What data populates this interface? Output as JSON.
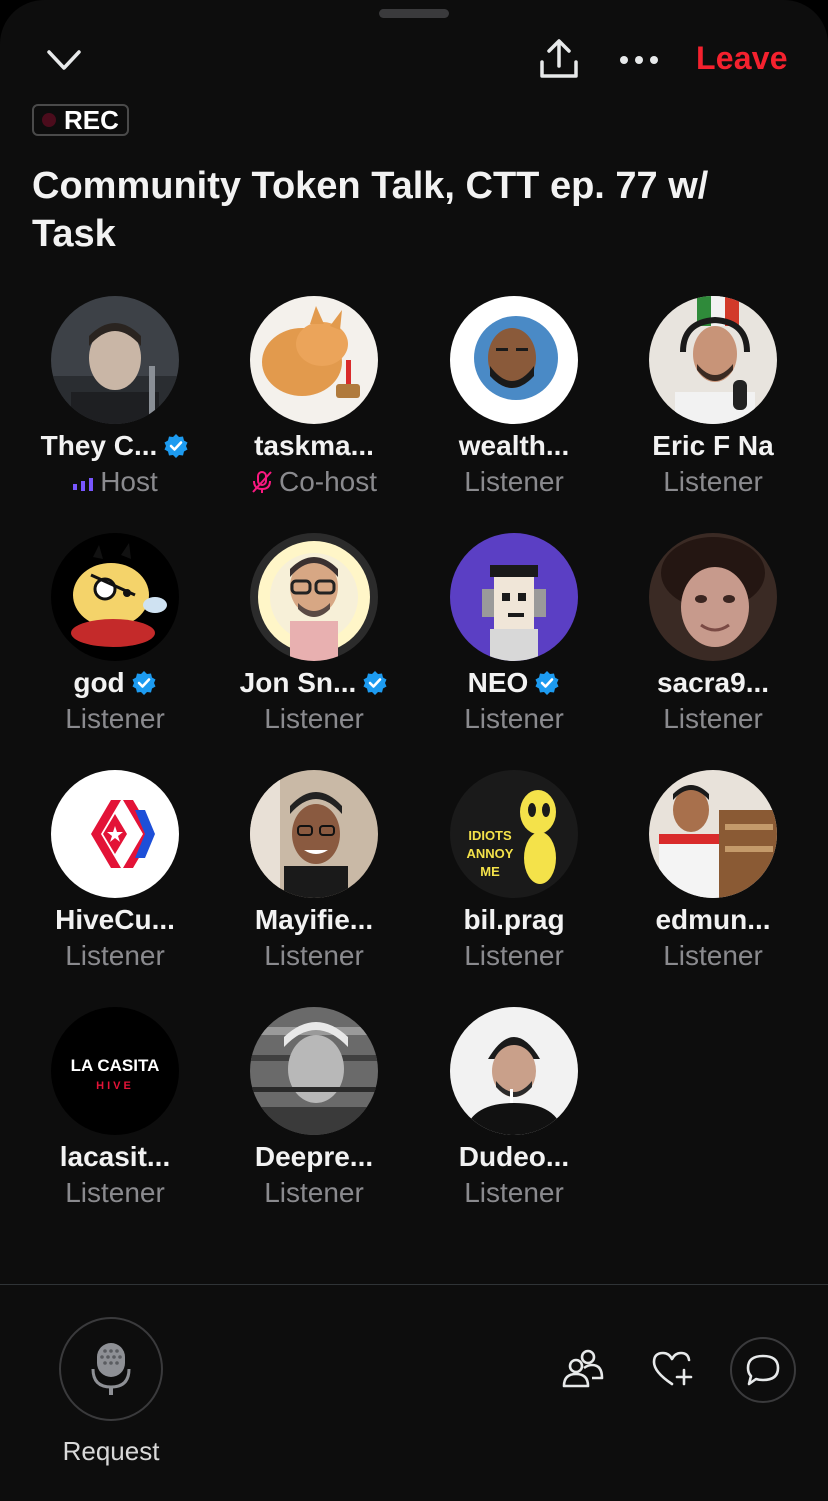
{
  "header": {
    "collapse_icon": "chevron-down-icon",
    "share_icon": "share-icon",
    "more_icon": "more-horizontal-icon",
    "leave_label": "Leave",
    "rec_label": "REC"
  },
  "space": {
    "title": "Community Token Talk, CTT ep. 77 w/ Task"
  },
  "colors": {
    "leave": "#f4212e",
    "verified": "#1d9bf0",
    "role_text": "#8a8a8e",
    "host_bars": "#7856ff",
    "cohost_mic": "#f91880"
  },
  "participants": [
    {
      "name": "They C...",
      "role": "Host",
      "verified": true,
      "role_icon": "speaking-bars-icon"
    },
    {
      "name": "taskma...",
      "role": "Co-host",
      "verified": false,
      "role_icon": "mic-muted-icon"
    },
    {
      "name": "wealth...",
      "role": "Listener",
      "verified": false
    },
    {
      "name": "Eric F Na",
      "role": "Listener",
      "verified": false
    },
    {
      "name": "god",
      "role": "Listener",
      "verified": true
    },
    {
      "name": "Jon Sn...",
      "role": "Listener",
      "verified": true
    },
    {
      "name": "NEO",
      "role": "Listener",
      "verified": true
    },
    {
      "name": "sacra9...",
      "role": "Listener",
      "verified": false
    },
    {
      "name": "HiveCu...",
      "role": "Listener",
      "verified": false
    },
    {
      "name": "Mayifie...",
      "role": "Listener",
      "verified": false
    },
    {
      "name": "bil.prag",
      "role": "Listener",
      "verified": false
    },
    {
      "name": "edmun...",
      "role": "Listener",
      "verified": false
    },
    {
      "name": "lacasit...",
      "role": "Listener",
      "verified": false
    },
    {
      "name": "Deepre...",
      "role": "Listener",
      "verified": false
    },
    {
      "name": "Dudeo...",
      "role": "Listener",
      "verified": false
    }
  ],
  "avatar_text": {
    "bilprag_line1": "IDIOTS",
    "bilprag_line2": "ANNOY",
    "bilprag_line3": "ME",
    "lacasita_line1": "LA CASITA",
    "lacasita_line2": "HIVE"
  },
  "bottom": {
    "request_label": "Request",
    "mic_icon": "microphone-icon",
    "people_icon": "people-icon",
    "heart_icon": "heart-plus-icon",
    "chat_icon": "chat-bubble-icon"
  }
}
